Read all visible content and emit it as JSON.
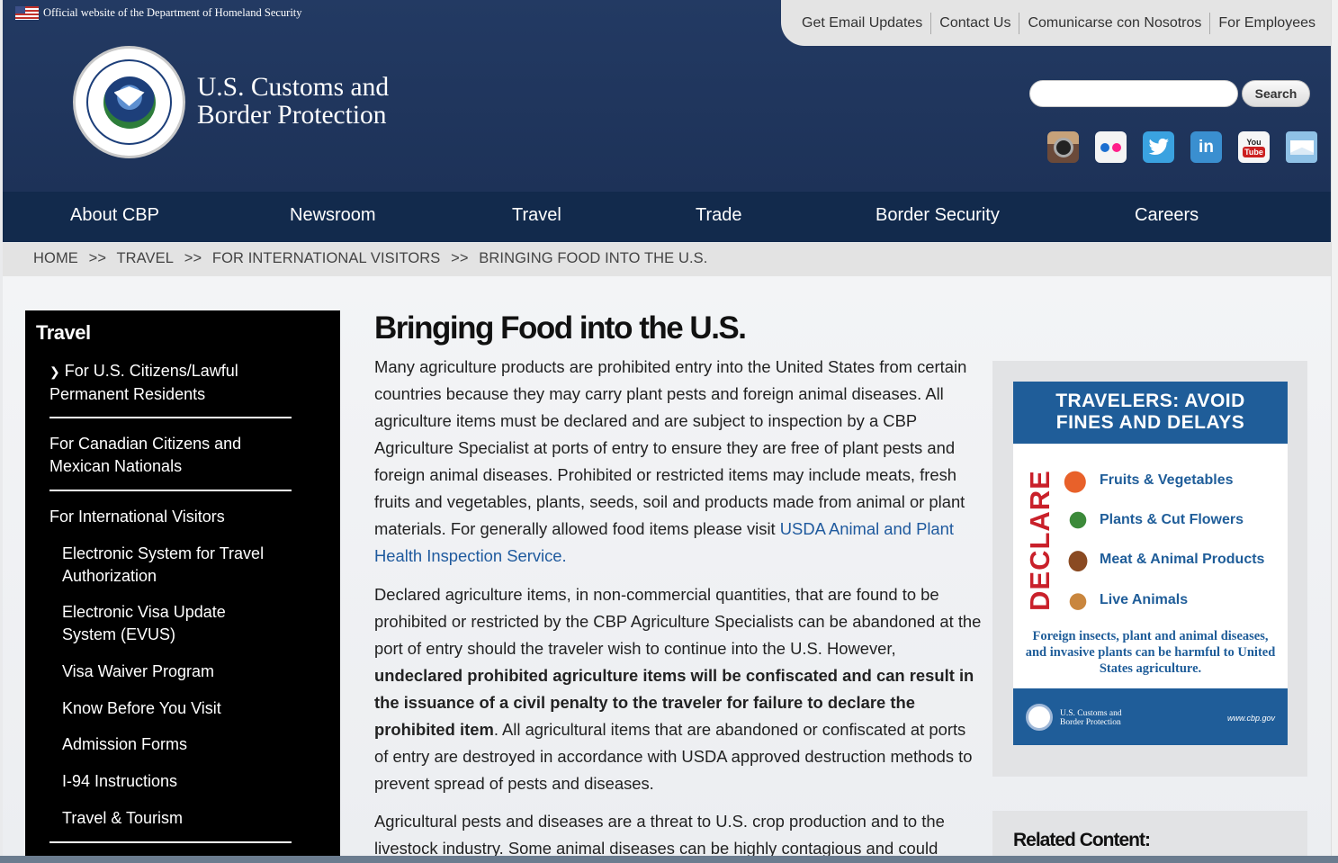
{
  "gov_banner": {
    "text": "Official website of the Department of Homeland Security"
  },
  "utility_links": [
    "Get Email Updates",
    "Contact Us",
    "Comunicarse con Nosotros",
    "For Employees"
  ],
  "agency": {
    "line1": "U.S. Customs and",
    "line2": "Border Protection"
  },
  "search": {
    "button": "Search",
    "value": ""
  },
  "social_icons": [
    "instagram-icon",
    "flickr-icon",
    "twitter-icon",
    "linkedin-icon",
    "youtube-icon",
    "email-icon"
  ],
  "social_labels": {
    "linkedin": "in",
    "youtube_top": "You",
    "youtube_bottom": "Tube"
  },
  "nav": [
    "About CBP",
    "Newsroom",
    "Travel",
    "Trade",
    "Border Security",
    "Careers"
  ],
  "breadcrumb": [
    "HOME",
    ">>",
    "TRAVEL",
    ">>",
    "FOR INTERNATIONAL VISITORS",
    ">>",
    "BRINGING FOOD INTO THE U.S."
  ],
  "sidebar": {
    "title": "Travel",
    "items": [
      {
        "label": "For U.S. Citizens/Lawful Permanent Residents"
      },
      {
        "label": "For Canadian Citizens and Mexican Nationals"
      },
      {
        "label": "For International Visitors"
      }
    ],
    "subitems": [
      "Electronic System for Travel Authorization",
      "Electronic Visa Update System (EVUS)",
      "Visa Waiver Program",
      "Know Before You Visit",
      "Admission Forms",
      "I-94 Instructions",
      "Travel & Tourism"
    ]
  },
  "main": {
    "title": "Bringing Food into the U.S.",
    "p1": "Many agriculture products are prohibited entry into the United States from certain countries because they may carry plant pests and foreign animal diseases.  All agriculture items must be declared and are subject to inspection by a CBP Agriculture Specialist at ports of entry to ensure they are free of plant pests and foreign animal diseases. Prohibited or restricted items may include meats, fresh fruits and vegetables, plants, seeds, soil and products made from animal or plant materials.  For generally allowed food items please visit ",
    "p1_link": "USDA Animal and Plant Health Inspection Service.",
    "p2a": "Declared agriculture items, in non-commercial quantities, that are found to be prohibited or restricted by the CBP Agriculture Specialists can be abandoned at the port of entry should the traveler wish to continue into the U.S. However, ",
    "p2_bold": "undeclared prohibited agriculture items will be confiscated and can result in the issuance of a civil penalty to the traveler for failure to declare the prohibited item",
    "p2b": ". All agricultural items that are abandoned or confiscated at ports of entry are destroyed in accordance with USDA approved destruction methods to prevent spread of pests and diseases.",
    "p3": "Agricultural pests and diseases are a threat to U.S. crop production and to the livestock industry. Some animal diseases can be highly contagious and could"
  },
  "promo": {
    "header_line1": "TRAVELERS: AVOID",
    "header_line2": "FINES AND DELAYS",
    "declare": "DECLARE",
    "items": [
      "Fruits & Vegetables",
      "Plants & Cut Flowers",
      "Meat & Animal Products",
      "Live Animals"
    ],
    "note": "Foreign insects, plant and animal diseases, and invasive plants can be harmful to United States agriculture.",
    "footer_name_line1": "U.S. Customs and",
    "footer_name_line2": "Border Protection",
    "footer_url": "www.cbp.gov"
  },
  "related": {
    "title": "Related Content:"
  },
  "colors": {
    "header": "#1d3258",
    "nav": "#122a4c",
    "link": "#1f5a9e",
    "declare": "#c9202a",
    "promo_blue": "#1f5d99"
  }
}
